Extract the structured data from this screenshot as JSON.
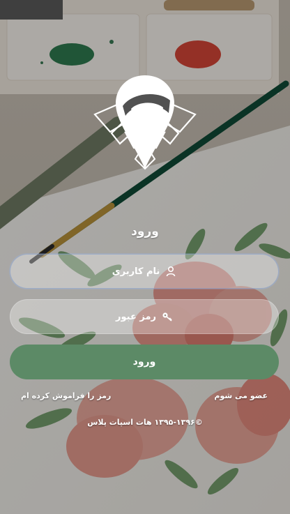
{
  "header": {
    "title": "ورود"
  },
  "form": {
    "username_placeholder": "نام کاربری",
    "password_placeholder": "رمز عبور",
    "submit_label": "ورود"
  },
  "links": {
    "register": "عضو می شوم",
    "forgot_password": "رمز را فراموش کرده ام"
  },
  "footer": {
    "copyright": "©۱۳۹۵-۱۳۹۶ هات اسپات پلاس"
  },
  "icons": {
    "logo": "location-pin-wifi-icon",
    "username": "user-icon",
    "password": "key-icon"
  },
  "colors": {
    "primary_button": "#5c8a66",
    "text": "#ffffff"
  }
}
